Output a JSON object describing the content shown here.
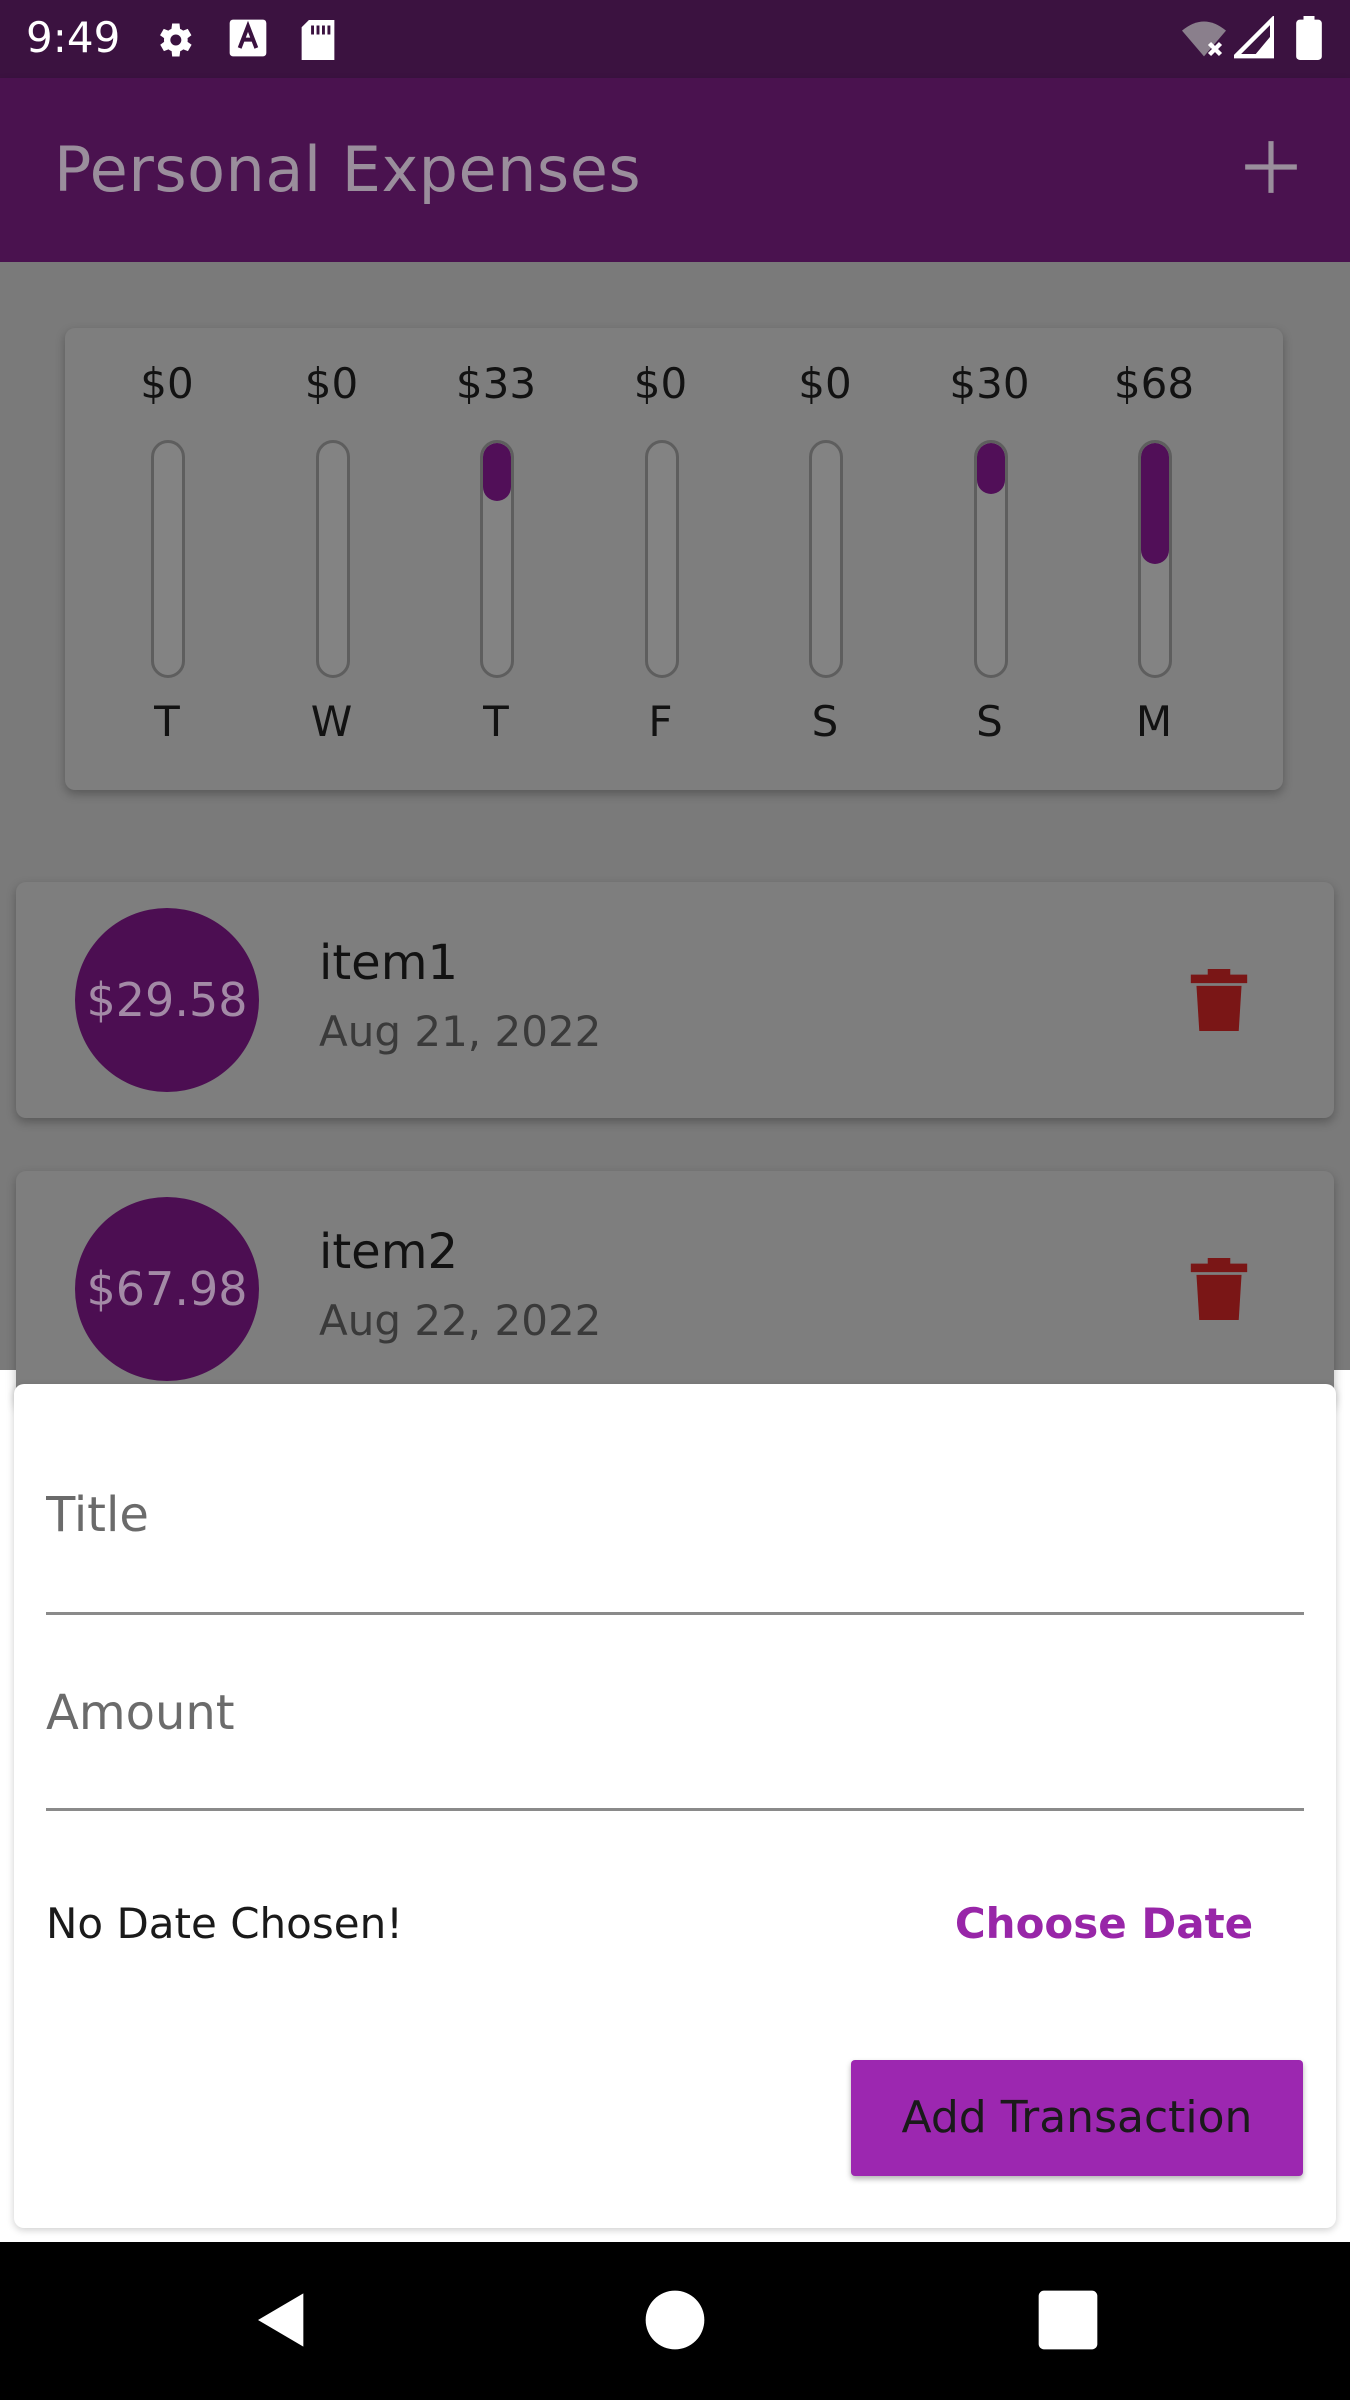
{
  "status_bar": {
    "time": "9:49",
    "icons": [
      "gear-icon",
      "a-letter-icon",
      "sd-card-icon",
      "wifi-off-icon",
      "signal-icon",
      "battery-icon"
    ]
  },
  "app_bar": {
    "title": "Personal Expenses",
    "action_icon": "plus-icon"
  },
  "chart_data": {
    "type": "bar",
    "categories": [
      "T",
      "W",
      "T",
      "F",
      "S",
      "S",
      "M"
    ],
    "values": [
      0,
      0,
      33,
      0,
      0,
      30,
      68
    ],
    "value_labels": [
      "$0",
      "$0",
      "$33",
      "$0",
      "$0",
      "$30",
      "$68"
    ],
    "fill_fractions": [
      0,
      0,
      0.25,
      0,
      0,
      0.22,
      0.52
    ],
    "title": "",
    "xlabel": "",
    "ylabel": ""
  },
  "transactions": [
    {
      "amount": "$29.58",
      "title": "item1",
      "date": "Aug 21, 2022",
      "delete_icon": "trash-icon"
    },
    {
      "amount": "$67.98",
      "title": "item2",
      "date": "Aug 22, 2022",
      "delete_icon": "trash-icon"
    }
  ],
  "form": {
    "title_placeholder": "Title",
    "title_value": "",
    "amount_placeholder": "Amount",
    "amount_value": "",
    "date_status": "No Date Chosen!",
    "choose_date_label": "Choose Date",
    "submit_label": "Add Transaction"
  },
  "nav_bar": {
    "icons": [
      "back-icon",
      "home-icon",
      "recents-icon"
    ]
  },
  "colors": {
    "status_bar": "#3b1240",
    "app_bar": "#4a124f",
    "accent": "#9c27b0",
    "chart_fill": "#510f58",
    "delete": "#7a1616"
  }
}
